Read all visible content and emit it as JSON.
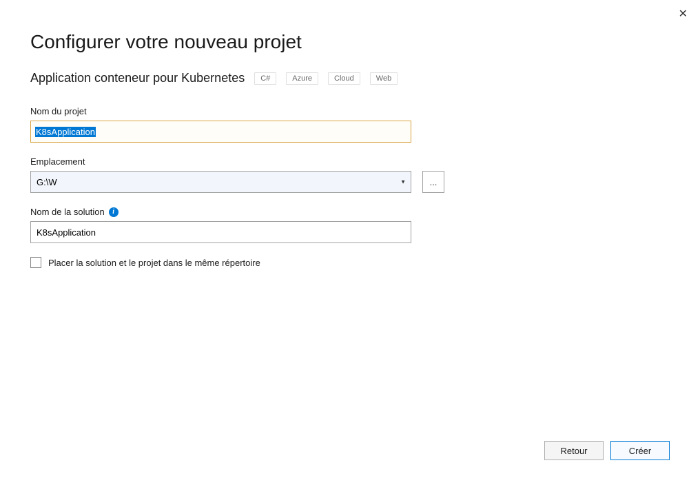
{
  "close_label": "✕",
  "title": "Configurer votre nouveau projet",
  "subtitle": "Application conteneur pour Kubernetes",
  "tags": [
    "C#",
    "Azure",
    "Cloud",
    "Web"
  ],
  "fields": {
    "project_name": {
      "label": "Nom du projet",
      "value": "K8sApplication"
    },
    "location": {
      "label": "Emplacement",
      "value": "G:\\W",
      "browse": "..."
    },
    "solution_name": {
      "label": "Nom de la solution",
      "value": "K8sApplication"
    }
  },
  "checkbox": {
    "label": "Placer la solution et le projet dans le même répertoire",
    "checked": false
  },
  "buttons": {
    "back": "Retour",
    "create": "Créer"
  }
}
